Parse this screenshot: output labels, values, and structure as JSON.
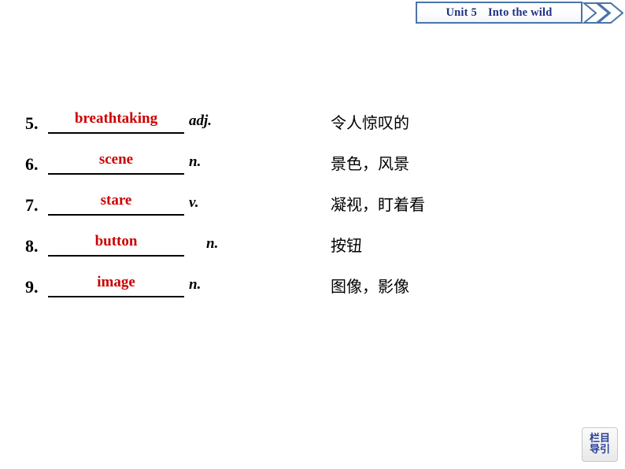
{
  "header": {
    "unit_label": "Unit 5",
    "unit_title": "Into the wild",
    "chevron_icon": "double-chevron-right-icon",
    "border_color": "#4b74a8",
    "text_color": "#1f3080"
  },
  "word_list": {
    "answer_color": "#cc0000",
    "items": [
      {
        "number": "5.",
        "answer": "breathtaking",
        "pos": "adj.",
        "pos_indent": false,
        "meaning": "令人惊叹的"
      },
      {
        "number": "6.",
        "answer": "scene",
        "pos": "n.",
        "pos_indent": false,
        "meaning": "景色，风景"
      },
      {
        "number": "7.",
        "answer": "stare",
        "pos": "v.",
        "pos_indent": false,
        "meaning": "凝视，盯着看"
      },
      {
        "number": "8.",
        "answer": "button",
        "pos": "n.",
        "pos_indent": true,
        "meaning": "按钮"
      },
      {
        "number": "9.",
        "answer": "image",
        "pos": "n.",
        "pos_indent": false,
        "meaning": "图像，影像"
      }
    ]
  },
  "nav_button": {
    "line1": "栏目",
    "line2": "导引",
    "text_color": "#2b3f95"
  }
}
